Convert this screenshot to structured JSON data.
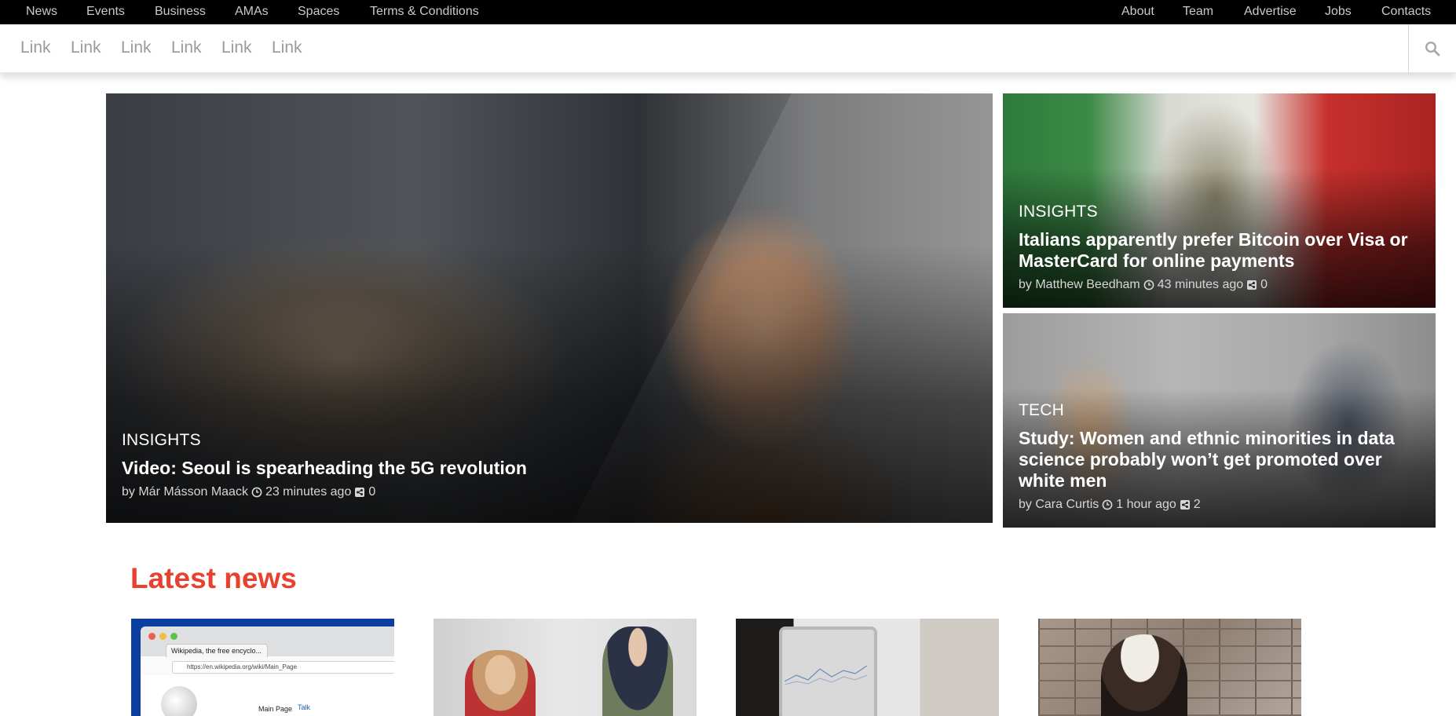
{
  "topbar": {
    "left": [
      "News",
      "Events",
      "Business",
      "AMAs",
      "Spaces",
      "Terms & Conditions"
    ],
    "right": [
      "About",
      "Team",
      "Advertise",
      "Jobs",
      "Contacts"
    ]
  },
  "secnav": {
    "links": [
      "Link",
      "Link",
      "Link",
      "Link",
      "Link",
      "Link"
    ],
    "search_icon": "search-icon"
  },
  "hero": {
    "main": {
      "category": "INSIGHTS",
      "title": "Video: Seoul is spearheading the 5G revolution",
      "author": "by Már Másson Maack",
      "time": "23 minutes ago",
      "shares": "0"
    },
    "side": [
      {
        "category": "INSIGHTS",
        "title": "Italians apparently prefer Bitcoin over Visa or MasterCard for online payments",
        "author": "by Matthew Beedham",
        "time": "43 minutes ago",
        "shares": "0"
      },
      {
        "category": "TECH",
        "title": "Study: Women and ethnic minorities in data science probably won’t get promoted over white men",
        "author": "by Cara Curtis",
        "time": "1 hour ago",
        "shares": "2"
      }
    ]
  },
  "latest": {
    "heading": "Latest news",
    "accent": "#e8412f",
    "thumb_text": {
      "wiki_tab": "Wikipedia, the free encyclo...",
      "wiki_url": "https://en.wikipedia.org/wiki/Main_Page",
      "wiki_main": "Main Page",
      "wiki_talk": "Talk"
    }
  }
}
